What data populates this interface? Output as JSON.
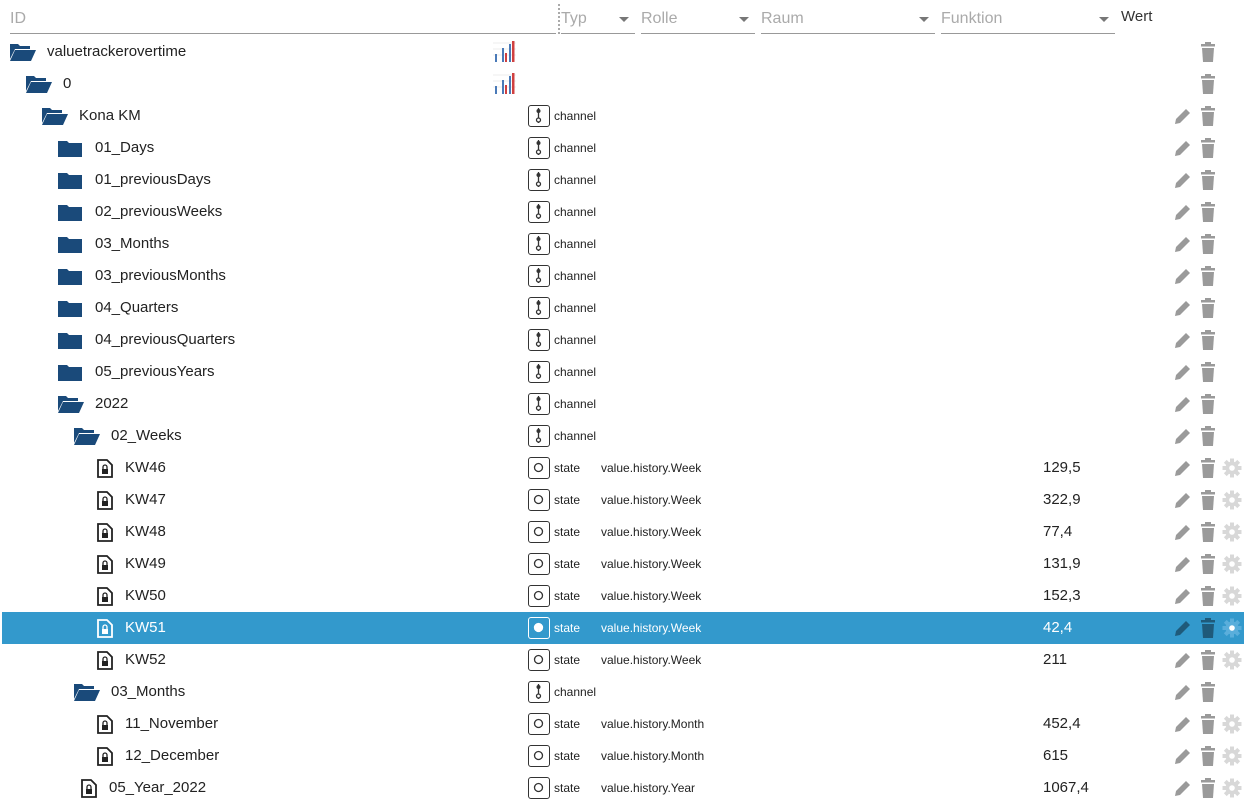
{
  "header": {
    "id_placeholder": "ID",
    "type_filter": "Typ",
    "role_filter": "Rolle",
    "room_filter": "Raum",
    "function_filter": "Funktion",
    "value_label": "Wert"
  },
  "colors": {
    "folder": "#1a4a7a",
    "selected": "#3399cc",
    "icon_gray": "#9a9a9a"
  },
  "rows": [
    {
      "level": 0,
      "icon": "folder-open",
      "name": "valuetrackerovertime",
      "type_icon": "chart",
      "actions": [
        "delete"
      ]
    },
    {
      "level": 1,
      "icon": "folder-open",
      "name": "0",
      "type_icon": "chart",
      "actions": [
        "delete"
      ]
    },
    {
      "level": 2,
      "icon": "folder-open",
      "name": "Kona KM",
      "type_icon": "channel",
      "type": "channel",
      "actions": [
        "edit",
        "delete"
      ]
    },
    {
      "level": 3,
      "icon": "folder",
      "name": "01_Days",
      "type_icon": "channel",
      "type": "channel",
      "actions": [
        "edit",
        "delete"
      ]
    },
    {
      "level": 3,
      "icon": "folder",
      "name": "01_previousDays",
      "type_icon": "channel",
      "type": "channel",
      "actions": [
        "edit",
        "delete"
      ]
    },
    {
      "level": 3,
      "icon": "folder",
      "name": "02_previousWeeks",
      "type_icon": "channel",
      "type": "channel",
      "actions": [
        "edit",
        "delete"
      ]
    },
    {
      "level": 3,
      "icon": "folder",
      "name": "03_Months",
      "type_icon": "channel",
      "type": "channel",
      "actions": [
        "edit",
        "delete"
      ]
    },
    {
      "level": 3,
      "icon": "folder",
      "name": "03_previousMonths",
      "type_icon": "channel",
      "type": "channel",
      "actions": [
        "edit",
        "delete"
      ]
    },
    {
      "level": 3,
      "icon": "folder",
      "name": "04_Quarters",
      "type_icon": "channel",
      "type": "channel",
      "actions": [
        "edit",
        "delete"
      ]
    },
    {
      "level": 3,
      "icon": "folder",
      "name": "04_previousQuarters",
      "type_icon": "channel",
      "type": "channel",
      "actions": [
        "edit",
        "delete"
      ]
    },
    {
      "level": 3,
      "icon": "folder",
      "name": "05_previousYears",
      "type_icon": "channel",
      "type": "channel",
      "actions": [
        "edit",
        "delete"
      ]
    },
    {
      "level": 3,
      "icon": "folder-open",
      "name": "2022",
      "type_icon": "channel",
      "type": "channel",
      "actions": [
        "edit",
        "delete"
      ]
    },
    {
      "level": 4,
      "icon": "folder-open",
      "name": "02_Weeks",
      "type_icon": "channel",
      "type": "channel",
      "actions": [
        "edit",
        "delete"
      ]
    },
    {
      "level": 5,
      "icon": "file",
      "name": "KW46",
      "type_icon": "state",
      "type": "state",
      "role": "value.history.Week",
      "value": "129,5",
      "actions": [
        "edit",
        "delete",
        "settings"
      ]
    },
    {
      "level": 5,
      "icon": "file",
      "name": "KW47",
      "type_icon": "state",
      "type": "state",
      "role": "value.history.Week",
      "value": "322,9",
      "actions": [
        "edit",
        "delete",
        "settings"
      ]
    },
    {
      "level": 5,
      "icon": "file",
      "name": "KW48",
      "type_icon": "state",
      "type": "state",
      "role": "value.history.Week",
      "value": "77,4",
      "actions": [
        "edit",
        "delete",
        "settings"
      ]
    },
    {
      "level": 5,
      "icon": "file",
      "name": "KW49",
      "type_icon": "state",
      "type": "state",
      "role": "value.history.Week",
      "value": "131,9",
      "actions": [
        "edit",
        "delete",
        "settings"
      ]
    },
    {
      "level": 5,
      "icon": "file",
      "name": "KW50",
      "type_icon": "state",
      "type": "state",
      "role": "value.history.Week",
      "value": "152,3",
      "actions": [
        "edit",
        "delete",
        "settings"
      ]
    },
    {
      "level": 5,
      "icon": "file",
      "name": "KW51",
      "type_icon": "state",
      "type": "state",
      "role": "value.history.Week",
      "value": "42,4",
      "selected": true,
      "actions": [
        "edit",
        "delete",
        "settings"
      ]
    },
    {
      "level": 5,
      "icon": "file",
      "name": "KW52",
      "type_icon": "state",
      "type": "state",
      "role": "value.history.Week",
      "value": "211",
      "actions": [
        "edit",
        "delete",
        "settings"
      ]
    },
    {
      "level": 4,
      "icon": "folder-open",
      "name": "03_Months",
      "type_icon": "channel",
      "type": "channel",
      "actions": [
        "edit",
        "delete"
      ]
    },
    {
      "level": 5,
      "icon": "file",
      "name": "11_November",
      "type_icon": "state",
      "type": "state",
      "role": "value.history.Month",
      "value": "452,4",
      "actions": [
        "edit",
        "delete",
        "settings"
      ]
    },
    {
      "level": 5,
      "icon": "file",
      "name": "12_December",
      "type_icon": "state",
      "type": "state",
      "role": "value.history.Month",
      "value": "615",
      "actions": [
        "edit",
        "delete",
        "settings"
      ]
    },
    {
      "level": 4,
      "icon": "file",
      "name": "05_Year_2022",
      "type_icon": "state",
      "type": "state",
      "role": "value.history.Year",
      "value": "1067,4",
      "actions": [
        "edit",
        "delete",
        "settings"
      ]
    }
  ]
}
